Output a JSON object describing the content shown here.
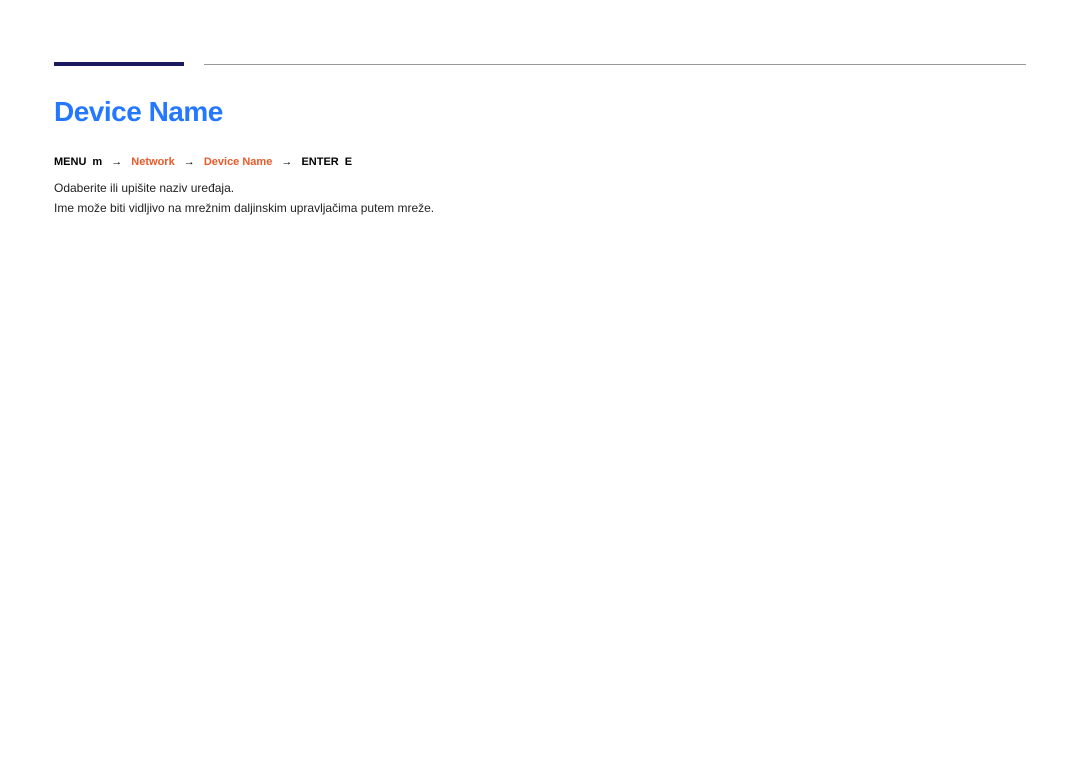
{
  "title": "Device Name",
  "menuPath": {
    "menuLabel": "MENU",
    "menuIcon": "m",
    "arrow1": "→",
    "network": "Network",
    "arrow2": "→",
    "deviceName": "Device Name",
    "arrow3": "→",
    "enterLabel": "ENTER",
    "enterIcon": "E"
  },
  "description": {
    "line1": "Odaberite ili upišite naziv uređaja.",
    "line2": "Ime može biti vidljivo na mrežnim daljinskim upravljačima putem mreže."
  }
}
